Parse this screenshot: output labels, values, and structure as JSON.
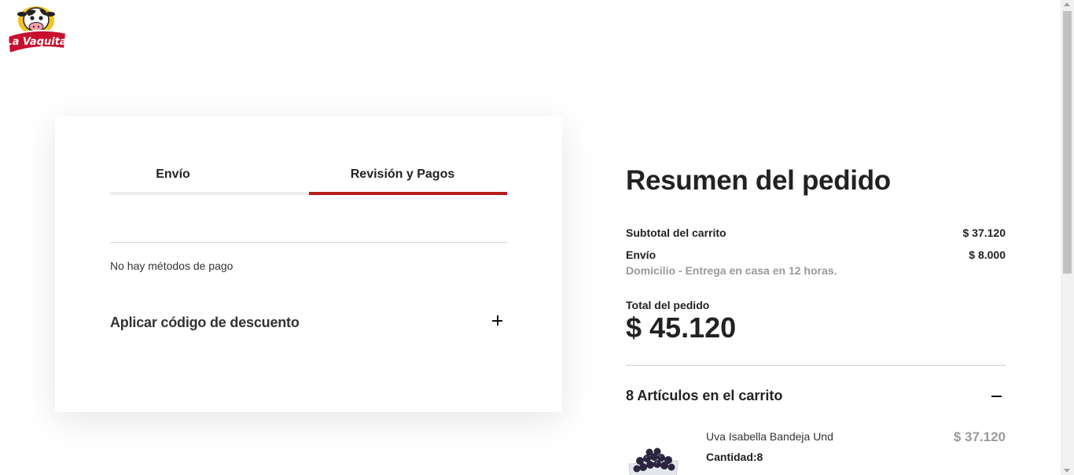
{
  "brand": {
    "logo_text": "La Vaquita",
    "logo_icon": "cow-logo-icon",
    "accent_color": "#b71c1c"
  },
  "checkout": {
    "tabs": [
      {
        "label": "Envío",
        "active": false
      },
      {
        "label": "Revisión y Pagos",
        "active": true
      }
    ],
    "no_payment_methods": "No hay métodos de pago",
    "discount_label": "Aplicar código de descuento",
    "discount_icon": "plus-icon"
  },
  "summary": {
    "title": "Resumen del pedido",
    "subtotal_label": "Subtotal del carrito",
    "subtotal_value": "$ 37.120",
    "shipping_label": "Envío",
    "shipping_value": "$ 8.000",
    "shipping_method": "Domicilio - Entrega en casa en 12 horas.",
    "total_label": "Total del pedido",
    "total_value": "$ 45.120",
    "cart_title": "8 Artículos en el carrito",
    "cart_toggle_icon": "minus-icon",
    "items": [
      {
        "name": "Uva Isabella Bandeja Und",
        "quantity": "Cantidad:8",
        "price": "$ 37.120",
        "image_icon": "grapes-tray-image"
      }
    ]
  }
}
